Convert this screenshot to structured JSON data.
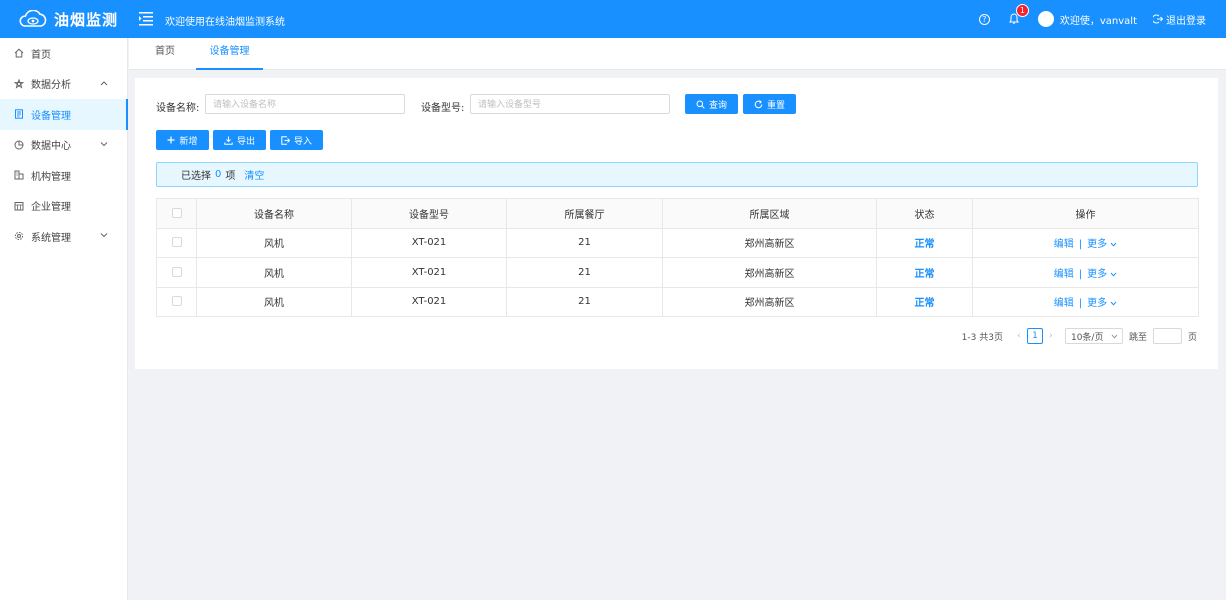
{
  "app": {
    "brand_name": "油烟监测",
    "welcome_banner": "欢迎使用在线油烟监测系统",
    "notification_count": "1",
    "user_greeting": "欢迎使，vanvalt",
    "logout_label": "退出登录"
  },
  "sidebar": {
    "items": [
      {
        "label": "首页",
        "icon": "home-icon"
      },
      {
        "label": "数据分析",
        "icon": "analysis-icon",
        "expand": "up"
      },
      {
        "label": "设备管理",
        "icon": "device-icon",
        "active": true
      },
      {
        "label": "数据中心",
        "icon": "data-center-icon",
        "expand": "down"
      },
      {
        "label": "机构管理",
        "icon": "org-icon"
      },
      {
        "label": "企业管理",
        "icon": "enterprise-icon"
      },
      {
        "label": "系统管理",
        "icon": "settings-icon",
        "expand": "down"
      }
    ]
  },
  "tabs": [
    {
      "label": "首页",
      "active": false
    },
    {
      "label": "设备管理",
      "active": true
    }
  ],
  "filters": {
    "name_label": "设备名称:",
    "name_placeholder": "请输入设备名称",
    "model_label": "设备型号:",
    "model_placeholder": "请输入设备型号",
    "query_label": "查询",
    "reset_label": "重置"
  },
  "toolbar": {
    "add_label": "新增",
    "export_label": "导出",
    "import_label": "导入"
  },
  "selection": {
    "prefix": "已选择",
    "count": "0",
    "suffix": "项",
    "clear_label": "清空"
  },
  "table": {
    "columns": [
      "设备名称",
      "设备型号",
      "所属餐厅",
      "所属区域",
      "状态",
      "操作"
    ],
    "rows": [
      {
        "name": "风机",
        "model": "XT-021",
        "restaurant": "21",
        "region": "郑州高新区",
        "status": "正常"
      },
      {
        "name": "风机",
        "model": "XT-021",
        "restaurant": "21",
        "region": "郑州高新区",
        "status": "正常"
      },
      {
        "name": "风机",
        "model": "XT-021",
        "restaurant": "21",
        "region": "郑州高新区",
        "status": "正常"
      }
    ],
    "edit_label": "编辑",
    "sep": "|",
    "more_label": "更多"
  },
  "pagination": {
    "summary": "1-3 共3页",
    "current_page": "1",
    "page_size": "10条/页",
    "jump_label": "跳至",
    "page_suffix": "页"
  },
  "colors": {
    "primary": "#1890ff",
    "alert_bg": "#e6f7ff",
    "badge": "#f5222d"
  }
}
